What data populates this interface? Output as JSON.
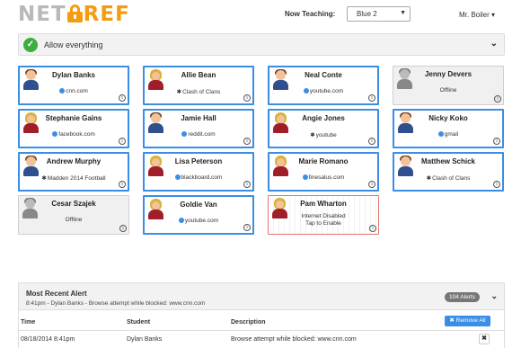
{
  "header": {
    "logo_left": "NET",
    "logo_right": "REF",
    "now_teaching_label": "Now Teaching:",
    "class_selected": "Blue 2",
    "user_menu": "Mr. Boiler ▾"
  },
  "allow_bar": {
    "label": "Allow everything",
    "accent": "#3cae3c"
  },
  "students": [
    {
      "name": "Dylan Banks",
      "activity": "cnn.com",
      "icon": "globe-icon",
      "avatar": "male",
      "state": "active"
    },
    {
      "name": "Allie Bean",
      "activity": "Clash of Clans",
      "icon": "app-icon",
      "avatar": "female",
      "state": "active"
    },
    {
      "name": "Neal Conte",
      "activity": "youtube.com",
      "icon": "globe-icon",
      "avatar": "male",
      "state": "active"
    },
    {
      "name": "Jenny Devers",
      "activity": "Offline",
      "icon": "",
      "avatar": "gray",
      "state": "offline"
    },
    {
      "name": "Stephanie Gains",
      "activity": "facebook.com",
      "icon": "globe-icon",
      "avatar": "female",
      "state": "active"
    },
    {
      "name": "Jamie Hall",
      "activity": "reddit.com",
      "icon": "globe-icon",
      "avatar": "male",
      "state": "active"
    },
    {
      "name": "Angie Jones",
      "activity": "youtube",
      "icon": "app-icon",
      "avatar": "female",
      "state": "active"
    },
    {
      "name": "Nicky Koko",
      "activity": "gmail",
      "icon": "globe-icon",
      "avatar": "male",
      "state": "active"
    },
    {
      "name": "Andrew Murphy",
      "activity": "Madden 2014 Football",
      "icon": "app-icon",
      "avatar": "male",
      "state": "active"
    },
    {
      "name": "Lisa Peterson",
      "activity": "blackboard.com",
      "icon": "globe-icon",
      "avatar": "female",
      "state": "active"
    },
    {
      "name": "Marie Romano",
      "activity": "finesalus.com",
      "icon": "globe-icon",
      "avatar": "female",
      "state": "active"
    },
    {
      "name": "Matthew Schick",
      "activity": "Clash of Clans",
      "icon": "app-icon",
      "avatar": "male",
      "state": "active"
    },
    {
      "name": "Cesar Szajek",
      "activity": "Offline",
      "icon": "",
      "avatar": "gray",
      "state": "offline"
    },
    {
      "name": "Goldie Van",
      "activity": "youtube.com",
      "icon": "globe-icon",
      "avatar": "female",
      "state": "active"
    },
    {
      "name": "Pam Wharton",
      "activity": "Internet Disabled",
      "activity2": "Tap to Enable",
      "icon": "",
      "avatar": "female",
      "state": "disabled"
    }
  ],
  "alerts": {
    "title": "Most Recent Alert",
    "summary": "8:41pm - Dylan Banks - Browse attempt while blocked: www.cnn.com",
    "badge": "104 Alerts",
    "remove_all": "✖ Remove All",
    "columns": [
      "Time",
      "Student",
      "Description"
    ],
    "rows": [
      {
        "time": "08/18/2014 8:41pm",
        "student": "Dylan Banks",
        "description": "Browse attempt while blocked: www.cnn.com"
      }
    ]
  }
}
